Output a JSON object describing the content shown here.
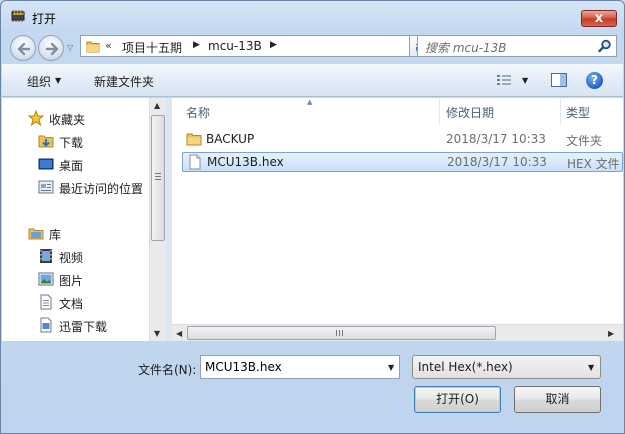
{
  "window": {
    "title": "打开",
    "close_label": "x"
  },
  "nav": {
    "address_prefix": "«",
    "breadcrumbs": [
      "项目十五期",
      "mcu-13B"
    ],
    "search_placeholder": "搜索 mcu-13B"
  },
  "toolbar": {
    "organize_label": "组织",
    "new_folder_label": "新建文件夹",
    "help_label": "?"
  },
  "sidebar": {
    "favorites": {
      "label": "收藏夹",
      "items": [
        {
          "label": "下载",
          "icon": "download-folder-icon"
        },
        {
          "label": "桌面",
          "icon": "desktop-icon"
        },
        {
          "label": "最近访问的位置",
          "icon": "recent-places-icon"
        }
      ]
    },
    "libraries": {
      "label": "库",
      "items": [
        {
          "label": "视频",
          "icon": "video-library-icon"
        },
        {
          "label": "图片",
          "icon": "pictures-library-icon"
        },
        {
          "label": "文档",
          "icon": "documents-library-icon"
        },
        {
          "label": "迅雷下载",
          "icon": "thunder-download-icon"
        }
      ]
    }
  },
  "columns": {
    "name": "名称",
    "date": "修改日期",
    "type": "类型"
  },
  "files": [
    {
      "name": "BACKUP",
      "date": "2018/3/17 10:33",
      "type": "文件夹",
      "icon": "folder-icon",
      "selected": false
    },
    {
      "name": "MCU13B.hex",
      "date": "2018/3/17 10:33",
      "type": "HEX 文件",
      "icon": "file-icon",
      "selected": true
    }
  ],
  "footer": {
    "filename_label": "文件名(N):",
    "filename_value": "MCU13B.hex",
    "filter_value": "Intel Hex(*.hex)",
    "open_label": "打开(O)",
    "cancel_label": "取消"
  },
  "colors": {
    "selection_bg": "#c8e0fa",
    "selection_border": "#7da2ce",
    "close_red": "#c13b26",
    "folder_yellow": "#e9c25a"
  }
}
